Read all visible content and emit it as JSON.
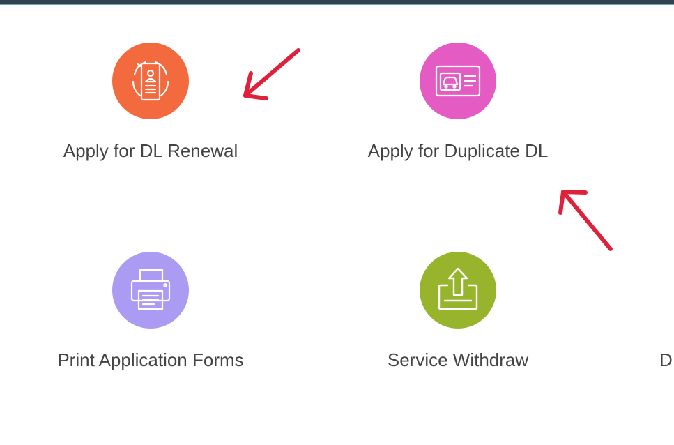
{
  "tiles": [
    {
      "id": "renewal",
      "label": "Apply for DL Renewal",
      "icon": "id-card-renewal-icon",
      "color": "#f26a3d"
    },
    {
      "id": "duplicate",
      "label": "Apply for Duplicate DL",
      "icon": "driving-license-icon",
      "color": "#e45bc4"
    },
    {
      "id": "print",
      "label": "Print Application Forms",
      "icon": "printer-icon",
      "color": "#ab9bf2"
    },
    {
      "id": "withdraw",
      "label": "Service Withdraw",
      "icon": "upload-tray-icon",
      "color": "#98b42c"
    }
  ],
  "partial_tile": {
    "label": "D"
  },
  "colors": {
    "top_bar": "#2f4450",
    "annotation_arrow": "#e0213b",
    "label_text": "#444444"
  }
}
